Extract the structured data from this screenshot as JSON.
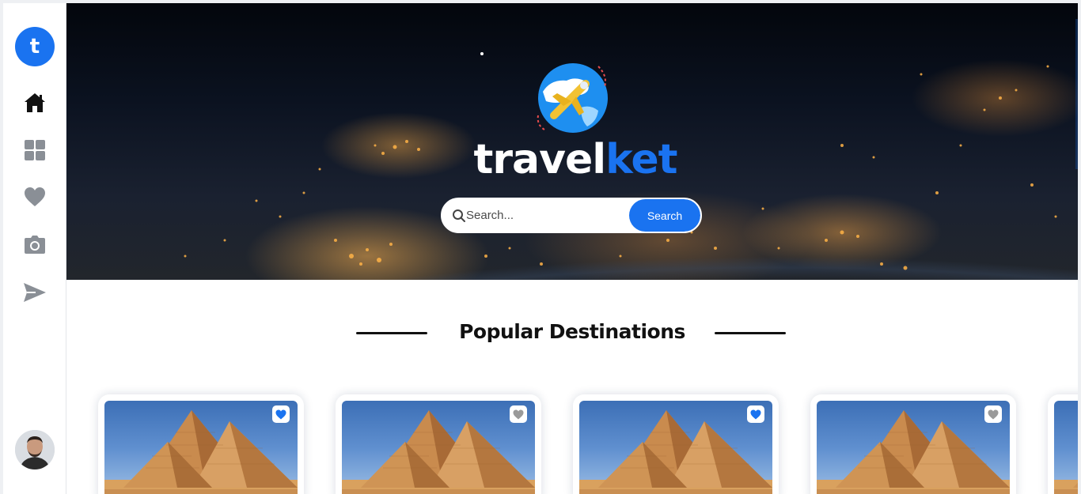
{
  "sidebar": {
    "logo_letter": "t",
    "nav": [
      {
        "name": "home",
        "icon": "home-icon",
        "active": true
      },
      {
        "name": "dashboard",
        "icon": "grid-icon",
        "active": false
      },
      {
        "name": "favorites",
        "icon": "heart-icon",
        "active": false
      },
      {
        "name": "photos",
        "icon": "camera-icon",
        "active": false
      },
      {
        "name": "send",
        "icon": "send-icon",
        "active": false
      }
    ],
    "avatar_icon": "user-avatar"
  },
  "hero": {
    "brand_part1": "travel",
    "brand_part2": "ket",
    "search": {
      "placeholder": "Search...",
      "value": "",
      "button_label": "Search"
    }
  },
  "section": {
    "title": "Popular Destinations"
  },
  "cards": [
    {
      "favorited": true
    },
    {
      "favorited": false
    },
    {
      "favorited": true
    },
    {
      "favorited": false
    }
  ],
  "colors": {
    "accent": "#1a73f0",
    "heart_active": "#1a73f0",
    "heart_inactive": "#9a9a9a",
    "icon_inactive": "#8a8f96"
  }
}
